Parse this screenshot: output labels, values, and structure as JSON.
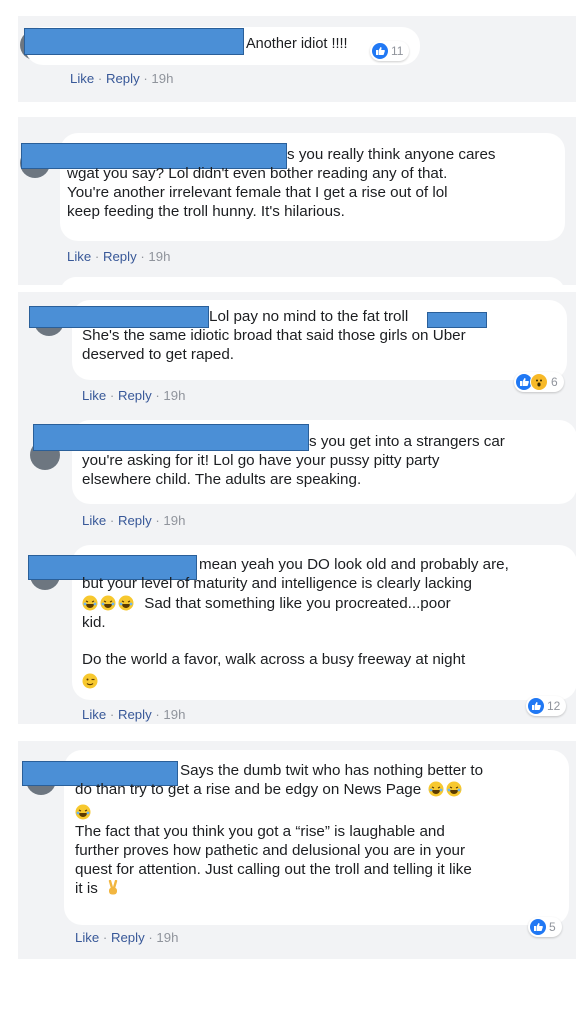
{
  "comments": [
    {
      "lines": [
        "Another idiot !!!!"
      ],
      "like_label": "Like",
      "reply_label": "Reply",
      "time": "19h",
      "reaction_count": "11"
    },
    {
      "lines": [
        "s you really think anyone cares",
        "wgat you say? Lol didn't even bother reading any of that.",
        "You're another irrelevant female that I get a rise out of lol",
        "keep feeding the troll hunny. It's hilarious."
      ],
      "like_label": "Like",
      "reply_label": "Reply",
      "time": "19h"
    },
    {
      "lines": [
        "Lol pay no mind to the fat troll",
        "She's the same idiotic broad that said those girls on Uber",
        "deserved to get raped."
      ],
      "like_label": "Like",
      "reply_label": "Reply",
      "time": "19h",
      "reaction_count": "6"
    },
    {
      "lines": [
        "s you get into a strangers car",
        "you're asking for it! Lol go have your pussy pitty party",
        "elsewhere child. The adults are speaking."
      ],
      "like_label": "Like",
      "reply_label": "Reply",
      "time": "19h"
    },
    {
      "lines": [
        "mean yeah you DO look old and probably are,",
        "but your level of maturity and intelligence is clearly lacking",
        "Sad that something like you procreated...poor",
        "kid.",
        "Do the world a favor, walk across a busy freeway at night"
      ],
      "like_label": "Like",
      "reply_label": "Reply",
      "time": "19h",
      "reaction_count": "12"
    },
    {
      "lines": [
        "Says the dumb twit who has nothing better to",
        "do than try to get a rise and be edgy on News Page",
        "The fact that you think you got a “rise” is laughable and",
        "further proves how pathetic and delusional you are in your",
        "quest for attention. Just calling out the troll and telling it like",
        "it is"
      ],
      "like_label": "Like",
      "reply_label": "Reply",
      "time": "19h",
      "reaction_count": "5"
    }
  ],
  "separator": "·",
  "colors": {
    "link": "#385898",
    "muted": "#90949c",
    "like_blue": "#2078f4",
    "redaction": "#4b8fd6",
    "panel": "#f2f3f5"
  }
}
